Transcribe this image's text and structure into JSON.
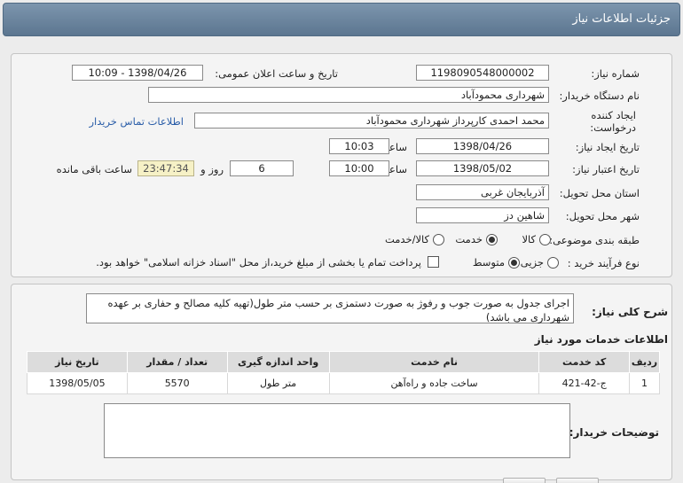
{
  "title": "جزئیات اطلاعات نیاز",
  "need_number": {
    "label": "شماره نیاز:",
    "value": "1198090548000002"
  },
  "announce": {
    "label": "تاریخ و ساعت اعلان عمومی:",
    "value": "1398/04/26 - 10:09"
  },
  "buyer": {
    "label": "نام دستگاه خریدار:",
    "value": "شهرداری محمودآباد"
  },
  "creator": {
    "label_line1": "ایجاد کننده",
    "label_line2": "درخواست:",
    "value": "محمد احمدی کارپرداز شهرداری محمودآباد",
    "contact_link": "اطلاعات تماس خریدار"
  },
  "created": {
    "label": "تاریخ ایجاد نیاز:",
    "date": "1398/04/26",
    "time_label": "ساعت",
    "time": "10:03"
  },
  "validity": {
    "label": "تاریخ اعتبار نیاز:",
    "date": "1398/05/02",
    "time_label": "ساعت",
    "time": "10:00",
    "days": "6",
    "days_label": "روز و",
    "remaining": "23:47:34",
    "remaining_label": "ساعت باقی مانده"
  },
  "province": {
    "label": "استان محل تحویل:",
    "value": "آذربایجان غربی"
  },
  "city": {
    "label": "شهر محل تحویل:",
    "value": "شاهین دز"
  },
  "category": {
    "label": "طبقه بندی موضوعی:",
    "options": [
      "کالا",
      "خدمت",
      "کالا/خدمت"
    ],
    "selected": "خدمت"
  },
  "process": {
    "label": "نوع فرآیند خرید :",
    "options": [
      "جزیی",
      "متوسط"
    ],
    "selected": "متوسط",
    "payment_note": "پرداخت تمام یا بخشی از مبلغ خرید،از محل \"اسناد خزانه اسلامی\" خواهد بود."
  },
  "summary": {
    "label": "شرح کلی نیاز:",
    "text": "اجرای جدول به صورت جوب و رفوژ به صورت دستمزی بر حسب متر طول(تهیه کلیه مصالح و حفاری بر عهده شهرداری می باشد)"
  },
  "services": {
    "title": "اطلاعات خدمات مورد نیاز",
    "headers": [
      "ردیف",
      "کد خدمت",
      "نام خدمت",
      "واحد اندازه گیری",
      "تعداد / مقدار",
      "تاریخ نیاز"
    ],
    "rows": [
      [
        "1",
        "ج-42-421",
        "ساخت جاده و راه‌آهن",
        "متر طول",
        "5570",
        "1398/05/05"
      ]
    ]
  },
  "buyer_notes": {
    "label": "توضیحات خریدار:",
    "value": ""
  }
}
